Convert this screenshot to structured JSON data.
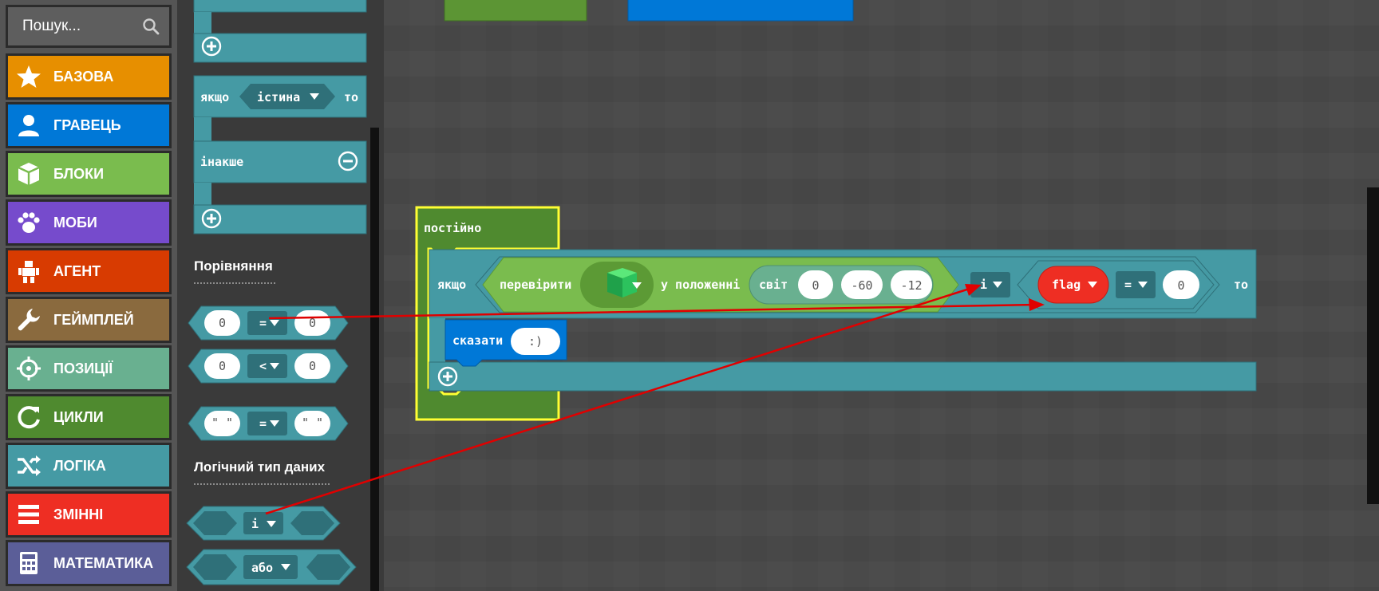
{
  "search": {
    "placeholder": "Пошук..."
  },
  "categories": [
    {
      "label": "БАЗОВА",
      "color": "#e78f00",
      "icon": "star-icon"
    },
    {
      "label": "ГРАВЕЦЬ",
      "color": "#0078d7",
      "icon": "person-icon"
    },
    {
      "label": "БЛОКИ",
      "color": "#7abc4e",
      "icon": "cube-icon"
    },
    {
      "label": "МОБИ",
      "color": "#764bcc",
      "icon": "paw-icon"
    },
    {
      "label": "АГЕНТ",
      "color": "#d83b01",
      "icon": "robot-icon"
    },
    {
      "label": "ГЕЙМПЛЕЙ",
      "color": "#8a6a3e",
      "icon": "wrench-icon"
    },
    {
      "label": "ПОЗИЦІЇ",
      "color": "#69b090",
      "icon": "crosshair-icon"
    },
    {
      "label": "ЦИКЛИ",
      "color": "#4f8a2f",
      "icon": "loop-icon"
    },
    {
      "label": "ЛОГІКА",
      "color": "#459aa4",
      "icon": "shuffle-icon"
    },
    {
      "label": "ЗМІННІ",
      "color": "#ee2e23",
      "icon": "list-icon"
    },
    {
      "label": "МАТЕМАТИКА",
      "color": "#5b5e98",
      "icon": "calculator-icon"
    }
  ],
  "flyout": {
    "if_label": "якщо",
    "true_label": "істина",
    "then_label": "то",
    "else_label": "інакше",
    "comparison_heading": "Порівняння",
    "cmp1": {
      "left": "0",
      "op": "=",
      "right": "0"
    },
    "cmp2": {
      "left": "0",
      "op": "<",
      "right": "0"
    },
    "cmp3": {
      "left": "\" \"",
      "op": "=",
      "right": "\" \""
    },
    "boolean_heading": "Логічний тип даних",
    "and_label": "і",
    "or_label": "або"
  },
  "workspace": {
    "forever_label": "постійно",
    "if_label": "якщо",
    "check_label": "перевірити",
    "at_position_label": "у положенні",
    "world_label": "світ",
    "coords": [
      "0",
      "-60",
      "-12"
    ],
    "and_label": "і",
    "var_name": "flag",
    "eq_op": "=",
    "compare_value": "0",
    "then_label": "то",
    "say_label": "сказати",
    "say_text": ":)"
  },
  "colors": {
    "logic": "#459aa4",
    "logic_dark": "#2f7079",
    "loop": "#4f8a2f",
    "blocks": "#7abc4e",
    "player": "#0078d7",
    "variable": "#ee2e23",
    "annotation_arrow": "#e00000"
  }
}
